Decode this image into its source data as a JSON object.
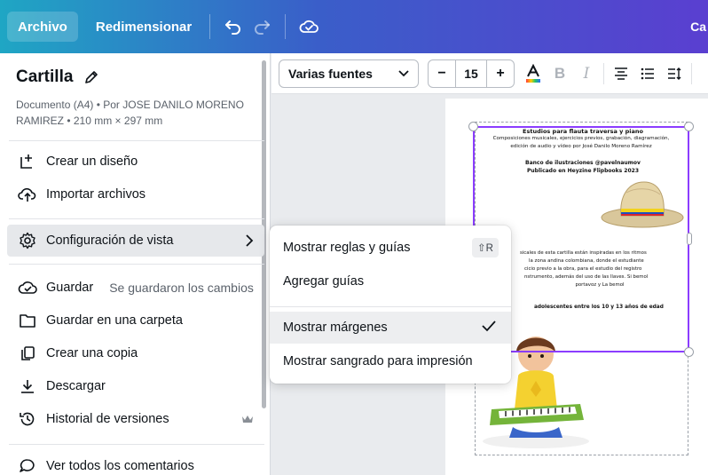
{
  "topbar": {
    "file_label": "Archivo",
    "resize_label": "Redimensionar",
    "right_label": "Ca"
  },
  "panel": {
    "doc_title": "Cartilla",
    "doc_meta": "Documento (A4) • Por JOSE DANILO MORENO RAMIREZ • 210 mm × 297 mm",
    "items": {
      "create": "Crear un diseño",
      "import": "Importar archivos",
      "view_config": "Configuración de vista",
      "save": "Guardar",
      "save_note": "Se guardaron los cambios",
      "save_folder": "Guardar en una carpeta",
      "copy": "Crear una copia",
      "download": "Descargar",
      "history": "Historial de versiones",
      "comments": "Ver todos los comentarios"
    }
  },
  "toolbar": {
    "font": "Varias fuentes",
    "size": "15",
    "minus": "−",
    "plus": "+"
  },
  "menu": {
    "rulers": "Mostrar reglas y guías",
    "rulers_shortcut": "⇧R",
    "add_guides": "Agregar guías",
    "margins": "Mostrar márgenes",
    "bleed": "Mostrar sangrado para impresión"
  },
  "page_content": {
    "title": "Estudios para flauta traversa y piano",
    "subtitle1": "Composiciones musicales, ejercicios previos, grabación, diagramación,",
    "subtitle2": "edición de audio y vídeo por José Danilo Moreno Ramírez",
    "credit1": "Banco de ilustraciones @pavelnaumov",
    "credit2": "Publicado en Heyzine Flipbooks 2023",
    "body1": "sicales de esta cartilla están inspiradas en los ritmos",
    "body2": "la zona andina colombiana, donde el estudiante",
    "body3": "cicio previo a la obra, para el estudio del registro",
    "body4": "nstrumento, además del uso de las llaves. Si bemol",
    "body5": "portavoz y La bemol",
    "body6": "adolescentes entre los 10 y 13 años de edad"
  },
  "colors": {
    "selection": "#8b3dff",
    "topbar_start": "#1fa6c4",
    "topbar_end": "#5a3fd0"
  }
}
